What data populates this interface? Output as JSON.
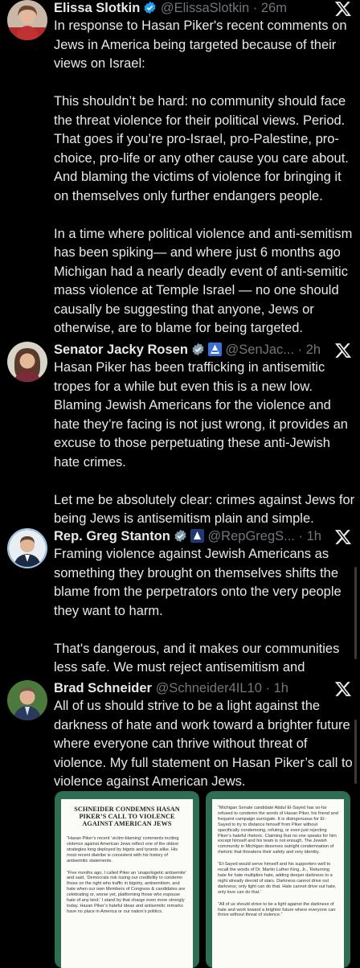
{
  "tweets": [
    {
      "name": "Elissa Slotkin",
      "handle": "@ElissaSlotkin",
      "time": "26m",
      "text": "In response to Hasan Piker's recent comments on Jews in America being targeted because of their views on Israel:\n\nThis shouldn’t be hard: no community should face the threat violence for their political views. Period. That goes if you’re pro-Israel, pro-Palestine, pro-choice, pro-life or any other cause you care about. And blaming the victims of violence for bringing it on themselves only further endangers people.\n\nIn a time where political violence and anti-semitism has been spiking— and where just 6 months ago Michigan had a nearly deadly event of anti-semitic mass violence at Temple Israel — no one should causally be suggesting that anyone, Jews or otherwise, are to blame for being targeted."
    },
    {
      "name": "Senator Jacky Rosen",
      "handle": "@SenJac...",
      "time": "2h",
      "text": "Hasan Piker has been trafficking in antisemitic tropes for a while but even this is a new low. Blaming Jewish Americans for the violence and hate they’re facing is not just wrong, it provides an excuse to those perpetuating these anti-Jewish hate crimes.\n\nLet me be absolutely clear: crimes against Jews for being Jews is antisemitism plain and simple. There’s no excuse for it."
    },
    {
      "name": "Rep. Greg Stanton",
      "handle": "@RepGregS...",
      "time": "1h",
      "text": "Framing violence against Jewish Americans as something they brought on themselves shifts the blame from the perpetrators onto the very people they want to harm.\n\nThat's dangerous, and it makes our communities less safe. We must reject antisemitism and intolerance in all its forms."
    },
    {
      "name": "Brad Schneider",
      "handle": "@Schneider4IL10",
      "time": "1h",
      "text": "All of us should strive to be a light against the darkness of hate and work toward a brighter future where everyone can thrive without threat of violence. My full statement on Hasan Piker’s call to violence against American Jews."
    }
  ],
  "statement_cards": [
    {
      "title": "SCHNEIDER CONDEMNS HASAN PIKER’S CALL TO VIOLENCE AGAINST AMERICAN JEWS",
      "paragraphs": [
        "“Hasan Piker’s recent ‘victim-blaming’ comments inciting violence against American Jews reflect one of the oldest strategies long deployed by bigots and tyrants alike. His most recent diatribe is consistent with his history of antisemitic statements.",
        "“Five months ago, I called Piker an ‘unapologetic antisemite’ and said, ‘Democrats risk losing our credibility to condemn those on the right who traffic in bigotry, antisemitism, and hate when our own Members of Congress & candidates are celebrating or, worse yet, platforming those who espouse hate of any kind.’ I stand by that charge even more strongly today. Hasan Piker’s hateful ideas and antisemitic remarks have no place in America or our nation’s politics."
      ]
    },
    {
      "title": "",
      "paragraphs": [
        "“Michigan Senate candidate Abdul El-Sayed has so-far refused to condemn the words of Hasan Piker, his friend and frequent campaign surrogate. It is disingenuous for El-Sayed to try to distance himself from Piker without specifically condemning, refuting, or even just rejecting Piker’s hateful rhetoric. Claiming that no one speaks for him except himself and his team is not enough. The Jewish community in Michigan deserves outright condemnation of rhetoric that threatens their safety and very identity.",
        "“El-Sayed would serve himself and his supporters well to recall the words of Dr. Martin Luther King, Jr., ‘Returning hate for hate multiplies hate, adding deeper darkness to a night already devoid of stars. Darkness cannot drive out darkness; only light can do that. Hate cannot drive out hate, only love can do that.’",
        "“All of us should strive to be a light against the darkness of hate and work toward a brighter future where everyone can thrive without threat of violence.”"
      ]
    }
  ],
  "colors": {
    "background": "#000000",
    "text": "#e7e9ea",
    "secondary": "#71767b",
    "verified_blue": "#1d9bf0",
    "verified_gray": "#829aab",
    "card_green": "#2f6e52"
  },
  "icons": [
    "x-logo-icon",
    "verified-badge-icon",
    "senate-badge-icon",
    "house-badge-icon"
  ]
}
